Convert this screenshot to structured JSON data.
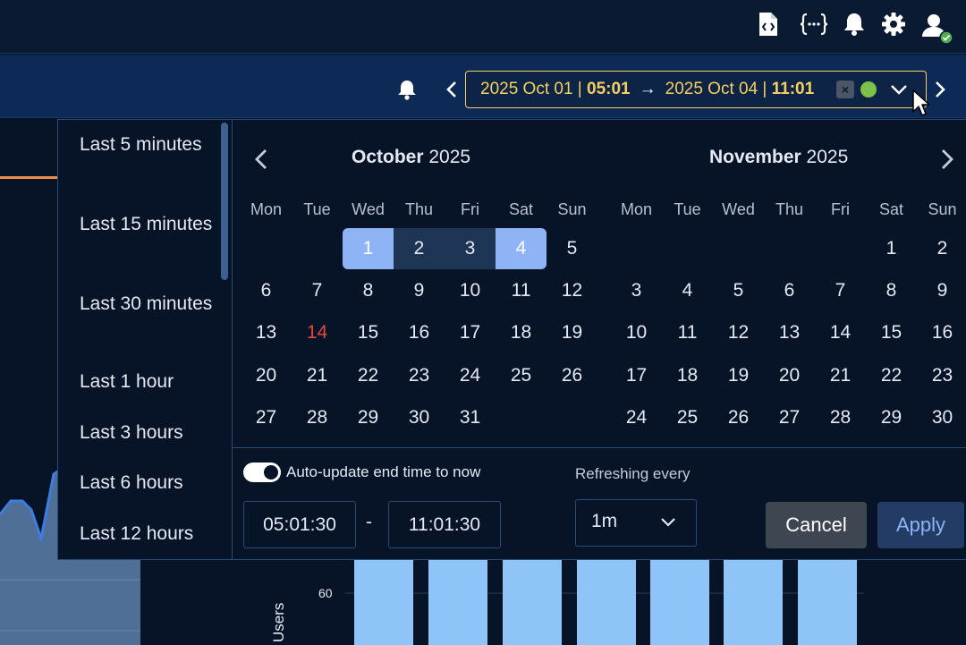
{
  "range": {
    "start_date": "2025 Oct 01 |",
    "start_time": "05:01",
    "arrow": "→",
    "end_date": "2025 Oct 04 |",
    "end_time": "11:01",
    "clear_glyph": "×"
  },
  "quick_ranges": [
    "Last 5 minutes",
    "Last 15 minutes",
    "Last 30 minutes",
    "Last 1 hour",
    "Last 3 hours",
    "Last 6 hours",
    "Last 12 hours"
  ],
  "weekdays": [
    "Mon",
    "Tue",
    "Wed",
    "Thu",
    "Fri",
    "Sat",
    "Sun"
  ],
  "calendars": [
    {
      "month": "October",
      "year": "2025",
      "first_weekday_index": 2,
      "days_in_month": 31,
      "today": 14,
      "selected_start": 1,
      "selected_end": 4
    },
    {
      "month": "November",
      "year": "2025",
      "first_weekday_index": 5,
      "days_in_month": 30
    }
  ],
  "auto_update_label": "Auto-update end time to now",
  "auto_update_on": true,
  "refreshing_label": "Refreshing every",
  "start_time_value": "05:01:30",
  "separator": "-",
  "end_time_value": "11:01:30",
  "refresh_value": "1m",
  "cancel_label": "Cancel",
  "apply_label": "Apply",
  "background": {
    "y_axis_label": "Users",
    "y_tick": "60"
  },
  "icons": [
    "file-code-icon",
    "json-braces-icon",
    "bell-icon",
    "gear-icon",
    "user-online-icon",
    "chevron-left-icon",
    "chevron-right-icon",
    "chevron-down-icon",
    "cursor-icon"
  ],
  "colors": {
    "accent_yellow": "#f5d060",
    "selected_end": "#8fb4f5",
    "selected_range": "#1f3555",
    "today": "#e5483c",
    "status_green": "#7cc24a"
  }
}
